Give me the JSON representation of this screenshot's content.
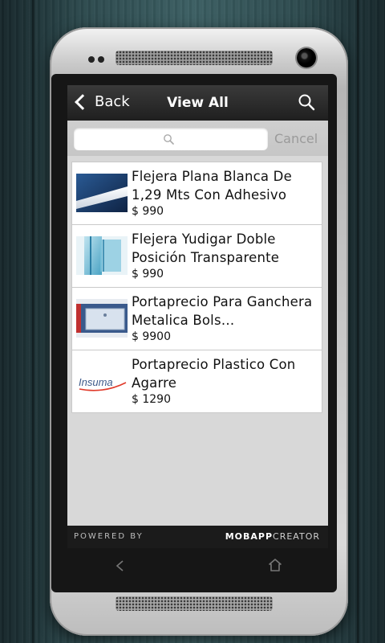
{
  "nav": {
    "back_label": "Back",
    "title": "View All",
    "search_icon": "search-icon"
  },
  "search": {
    "placeholder": "",
    "value": "",
    "cancel_label": "Cancel"
  },
  "products": [
    {
      "title": "Flejera Plana Blanca De 1,29 Mts Con Adhesivo",
      "price": "$ 990",
      "thumb": "flat-white-strip"
    },
    {
      "title": "Flejera Yudigar Doble Posición Transparente",
      "price": "$ 990",
      "thumb": "transparent-double-strip"
    },
    {
      "title": "Portaprecio Para Ganchera Metalica Bols…",
      "price": "$ 9900",
      "thumb": "price-holder-hook"
    },
    {
      "title": "Portaprecio Plastico Con Agarre",
      "price": "$ 1290",
      "thumb": "insuma-logo",
      "thumb_text": "Insuma"
    }
  ],
  "footer": {
    "powered_by": "POWERED BY",
    "brand_bold": "MOBAPP",
    "brand_light": "CREATOR"
  },
  "colors": {
    "nav_bg": "#262626",
    "list_bg": "#d8d8d8",
    "accent_text": "#111111",
    "cancel": "#9a9a9a"
  }
}
